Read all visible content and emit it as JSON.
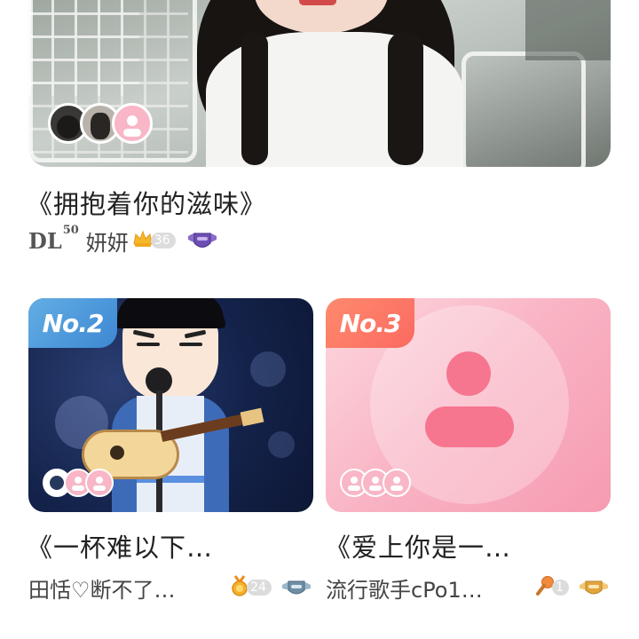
{
  "cards": [
    {
      "title": "《拥抱着你的滋味》",
      "badge_prefix": "DL",
      "badge_sup": "50",
      "singer": "妍妍",
      "level_icon": "crown-icon",
      "level": "36",
      "rank_icon": "purple-shield-badge-icon"
    },
    {
      "rank": "No.2",
      "title": "《一杯难以下…",
      "singer": "田恬♡断不了…",
      "level_icon": "gold-medal-icon",
      "level": "24",
      "rank_icon": "silver-shield-badge-icon"
    },
    {
      "rank": "No.3",
      "title": "《爱上你是一…",
      "singer": "流行歌手cPo1…",
      "level_icon": "microphone-icon",
      "level": "1",
      "rank_icon": "gold-shield-badge-icon"
    }
  ],
  "colors": {
    "rank2": "#4a9ae0",
    "rank3": "#fb7465",
    "placeholder_pink": "#f6758f"
  }
}
